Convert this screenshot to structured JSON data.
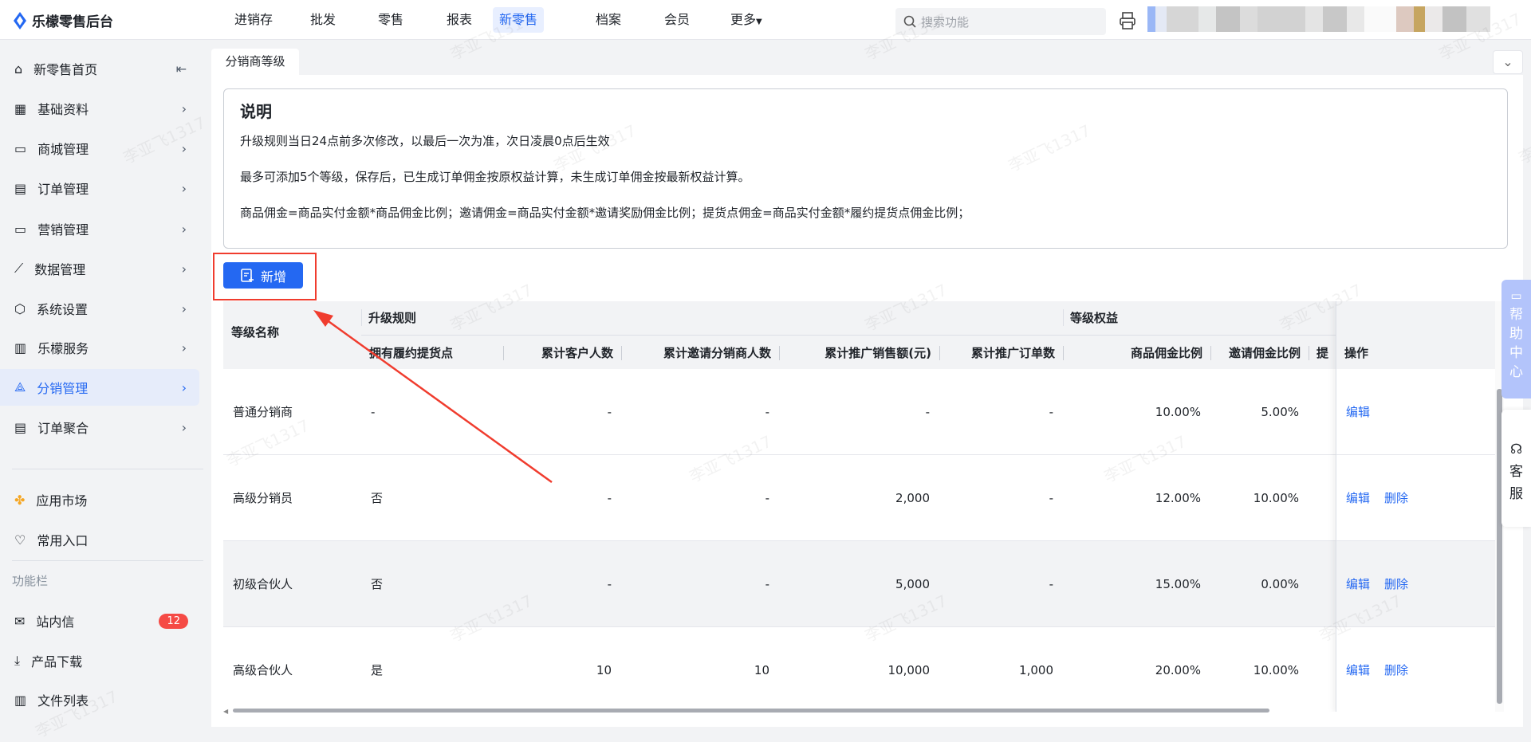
{
  "app": {
    "title": "乐檬零售后台"
  },
  "nav": [
    {
      "label": "进销存"
    },
    {
      "label": "批发"
    },
    {
      "label": "零售"
    },
    {
      "label": "报表"
    },
    {
      "label": "新零售",
      "active": true
    },
    {
      "label": "档案"
    },
    {
      "label": "会员"
    },
    {
      "label": "更多"
    }
  ],
  "search": {
    "placeholder": "搜索功能"
  },
  "sidebar": {
    "items": [
      {
        "label": "新零售首页"
      },
      {
        "label": "基础资料"
      },
      {
        "label": "商城管理"
      },
      {
        "label": "订单管理"
      },
      {
        "label": "营销管理"
      },
      {
        "label": "数据管理"
      },
      {
        "label": "系统设置"
      },
      {
        "label": "乐檬服务"
      },
      {
        "label": "分销管理",
        "active": true
      },
      {
        "label": "订单聚合"
      }
    ],
    "extra": [
      {
        "label": "应用市场"
      },
      {
        "label": "常用入口"
      }
    ],
    "section_title": "功能栏",
    "tools": [
      {
        "label": "站内信",
        "badge": "12"
      },
      {
        "label": "产品下载"
      },
      {
        "label": "文件列表"
      }
    ]
  },
  "tab": {
    "label": "分销商等级"
  },
  "note": {
    "title": "说明",
    "lines": [
      "升级规则当日24点前多次修改，以最后一次为准，次日凌晨0点后生效",
      "最多可添加5个等级，保存后，已生成订单佣金按原权益计算，未生成订单佣金按最新权益计算。",
      "商品佣金=商品实付金额*商品佣金比例；邀请佣金=商品实付金额*邀请奖励佣金比例；提货点佣金=商品实付金额*履约提货点佣金比例；"
    ]
  },
  "add_button": {
    "label": "新增"
  },
  "table": {
    "group_headers": {
      "name": "等级名称",
      "upgrade": "升级规则",
      "rights": "等级权益",
      "ops": "操作"
    },
    "columns": [
      "拥有履约提货点",
      "累计客户人数",
      "累计邀请分销商人数",
      "累计推广销售额(元)",
      "累计推广订单数",
      "商品佣金比例",
      "邀请佣金比例",
      "提"
    ],
    "rows": [
      {
        "name": "普通分销商",
        "cells": [
          "-",
          "-",
          "-",
          "-",
          "-",
          "10.00%",
          "5.00%"
        ],
        "actions": [
          "编辑"
        ]
      },
      {
        "name": "高级分销员",
        "cells": [
          "否",
          "-",
          "-",
          "2,000",
          "-",
          "12.00%",
          "10.00%"
        ],
        "actions": [
          "编辑",
          "删除"
        ]
      },
      {
        "name": "初级合伙人",
        "cells": [
          "否",
          "-",
          "-",
          "5,000",
          "-",
          "15.00%",
          "0.00%"
        ],
        "actions": [
          "编辑",
          "删除"
        ]
      },
      {
        "name": "高级合伙人",
        "cells": [
          "是",
          "10",
          "10",
          "10,000",
          "1,000",
          "20.00%",
          "10.00%"
        ],
        "actions": [
          "编辑",
          "删除"
        ]
      }
    ]
  },
  "help": {
    "help_center": "帮助中心",
    "customer_service": "客服"
  },
  "watermark": "李亚飞1317",
  "colors": {
    "accent": "#2468f2",
    "annotation": "#f03c2e",
    "badge": "#f54a45"
  }
}
